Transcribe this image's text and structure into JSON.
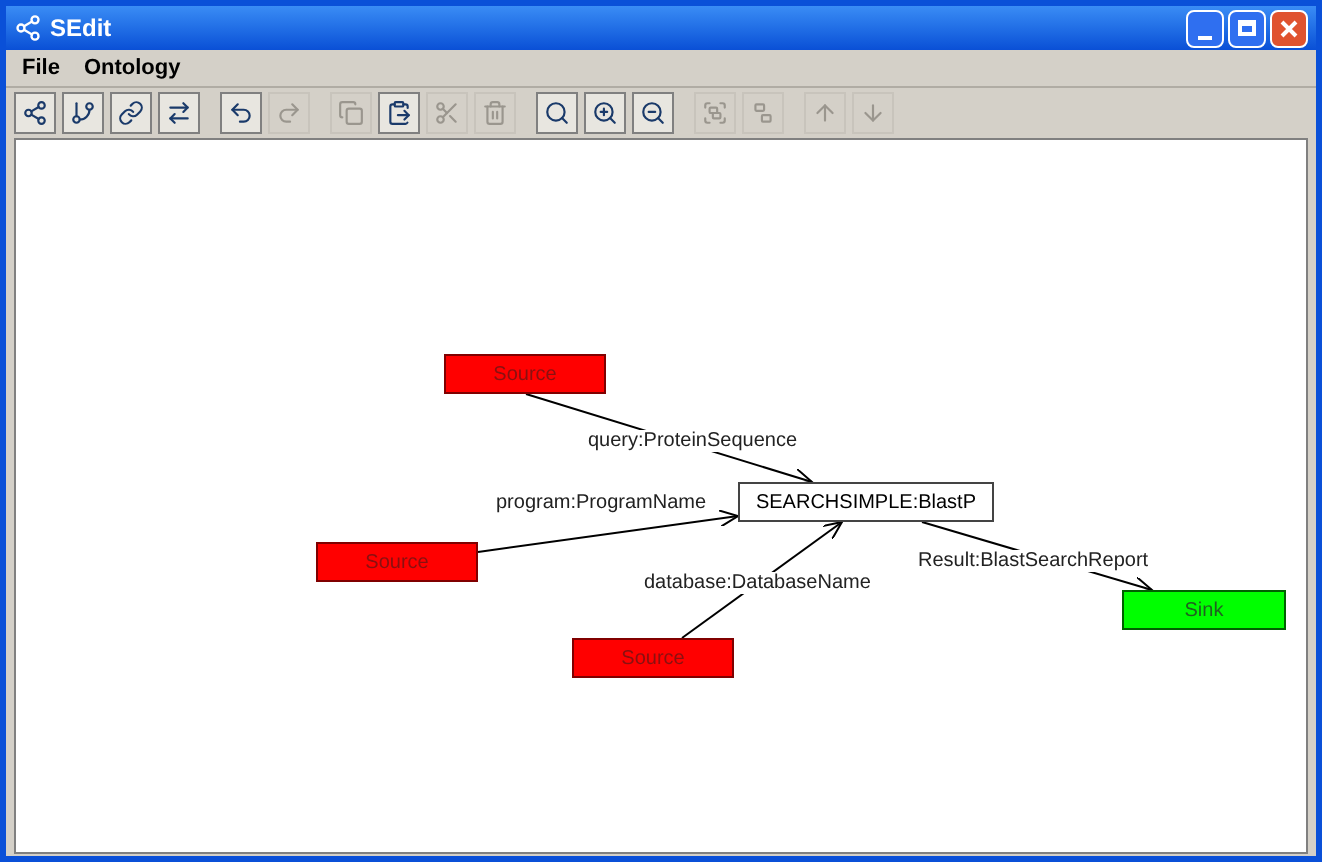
{
  "window": {
    "title": "SEdit"
  },
  "menu": [
    "File",
    "Ontology"
  ],
  "toolbar": [
    [
      {
        "disabled": false
      },
      {
        "disabled": false
      },
      {
        "disabled": false
      },
      {
        "disabled": false
      }
    ],
    [
      {
        "disabled": false
      },
      {
        "disabled": true
      }
    ],
    [
      {
        "disabled": true
      },
      {
        "disabled": false
      },
      {
        "disabled": true
      },
      {
        "disabled": true
      }
    ],
    [
      {
        "disabled": false
      },
      {
        "disabled": false
      },
      {
        "disabled": false
      }
    ],
    [
      {
        "disabled": true
      },
      {
        "disabled": true
      }
    ],
    [
      {
        "disabled": true
      },
      {
        "disabled": true
      }
    ]
  ],
  "graph": {
    "nodes": [
      {
        "label": "Source",
        "kind": "source",
        "color": "#ff0000"
      },
      {
        "label": "SEARCHSIMPLE:BlastP",
        "kind": "service",
        "color": "#ffffff"
      },
      {
        "label": "Source",
        "kind": "source",
        "color": "#ff0000"
      },
      {
        "label": "Source",
        "kind": "source",
        "color": "#ff0000"
      },
      {
        "label": "Sink",
        "kind": "sink",
        "color": "#00ff00"
      }
    ],
    "edges": [
      {
        "label": "query:ProteinSequence"
      },
      {
        "label": "program:ProgramName"
      },
      {
        "label": "database:DatabaseName"
      },
      {
        "label": "Result:BlastSearchReport"
      }
    ]
  }
}
